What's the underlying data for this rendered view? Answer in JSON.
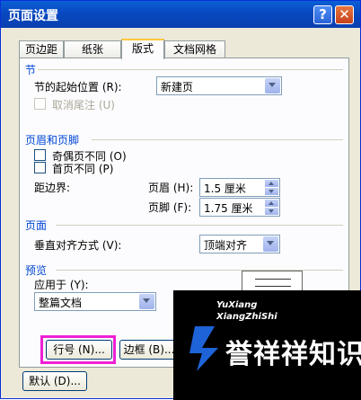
{
  "window": {
    "title": "页面设置",
    "help_icon": "?",
    "close_icon": "✕"
  },
  "tabs": [
    {
      "label": "页边距"
    },
    {
      "label": "纸张"
    },
    {
      "label": "版式",
      "active": true
    },
    {
      "label": "文档网格"
    }
  ],
  "section": {
    "header": "节",
    "start_label": "节的起始位置 (R):",
    "start_value": "新建页",
    "suppress_endnotes": "取消尾注 (U)"
  },
  "headers_footers": {
    "header": "页眉和页脚",
    "odd_even": "奇偶页不同 (O)",
    "first_page": "首页不同 (P)",
    "from_edge": "距边界:",
    "header_label": "页眉 (H):",
    "header_value": "1.5 厘米",
    "footer_label": "页脚 (F):",
    "footer_value": "1.75 厘米"
  },
  "page": {
    "header": "页面",
    "valign_label": "垂直对齐方式 (V):",
    "valign_value": "顶端对齐"
  },
  "preview": {
    "header": "预览",
    "apply_label": "应用于 (Y):",
    "apply_value": "整篇文档"
  },
  "buttons": {
    "line_numbers": "行号 (N)...",
    "borders": "边框 (B)...",
    "default": "默认 (D)..."
  },
  "watermark": {
    "line1": "YuXiang",
    "line2": "XiangZhiShi",
    "text": "誉祥祥知识",
    "color": "#1e63d8"
  }
}
